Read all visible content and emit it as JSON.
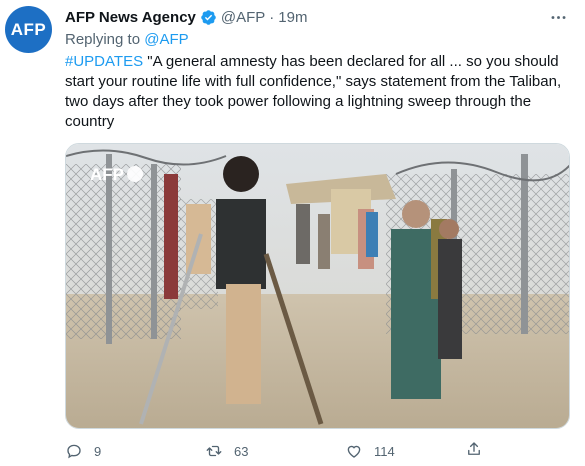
{
  "author": {
    "avatar_text": "AFP",
    "name": "AFP News Agency",
    "handle": "@AFP",
    "separator": "·",
    "time": "19m"
  },
  "replying": {
    "prefix": "Replying to",
    "to": "@AFP"
  },
  "tweet": {
    "hashtag": "#UPDATES",
    "body": " \"A general amnesty has been declared for all ... so you should start your routine life with full confidence,\" says statement from the Taliban, two days after they took power following a lightning sweep through the country"
  },
  "media": {
    "watermark": "AFP"
  },
  "actions": {
    "reply_count": "9",
    "retweet_count": "63",
    "like_count": "114"
  },
  "icons": [
    "avatar",
    "verified-icon",
    "more-icon",
    "reply-icon",
    "retweet-icon",
    "like-icon",
    "share-icon"
  ],
  "colors": {
    "link": "#1d9bf0",
    "secondary": "#536471",
    "avatar_bg": "#1d6fc4"
  }
}
